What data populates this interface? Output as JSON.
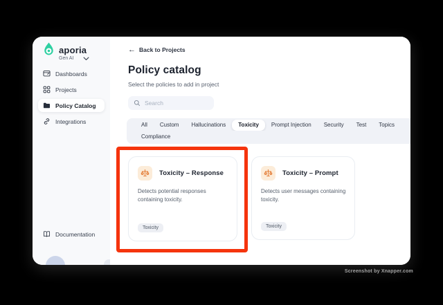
{
  "watermark": "Screenshot by Xnapper.com",
  "colors": {
    "annotation_red": "#f5340d",
    "brand_teal": "#2fd0a2",
    "card_icon_orange": "#e2762e",
    "card_icon_bg": "#fcecd9",
    "sidebar_bg": "#f8f9fb",
    "tabs_bar_bg": "#f0f2f7"
  },
  "sidebar": {
    "brand": {
      "name": "aporia",
      "workspace": "Gen AI"
    },
    "items": [
      {
        "label": "Dashboards",
        "icon": "dashboards-icon",
        "active": false
      },
      {
        "label": "Projects",
        "icon": "projects-icon",
        "active": false
      },
      {
        "label": "Policy Catalog",
        "icon": "folder-icon",
        "active": true
      },
      {
        "label": "Integrations",
        "icon": "integrations-icon",
        "active": false
      }
    ],
    "footer": {
      "label": "Documentation",
      "icon": "book-icon"
    }
  },
  "main": {
    "back_link": {
      "label": "Back to Projects",
      "arrow": "←"
    },
    "title": "Policy catalog",
    "subtitle": "Select the policies to add in project",
    "search": {
      "placeholder": "Search"
    },
    "tabs": {
      "row1": [
        "All",
        "Custom",
        "Hallucinations",
        "Toxicity",
        "Prompt Injection",
        "Security",
        "Test",
        "Topics"
      ],
      "row2": [
        "Compliance"
      ],
      "active": "Toxicity"
    },
    "cards": [
      {
        "title": "Toxicity – Response",
        "description": "Detects potential responses containing toxicity.",
        "tag": "Toxicity",
        "highlighted": true
      },
      {
        "title": "Toxicity – Prompt",
        "description": "Detects user messages containing toxicity.",
        "tag": "Toxicity",
        "highlighted": false
      }
    ]
  }
}
